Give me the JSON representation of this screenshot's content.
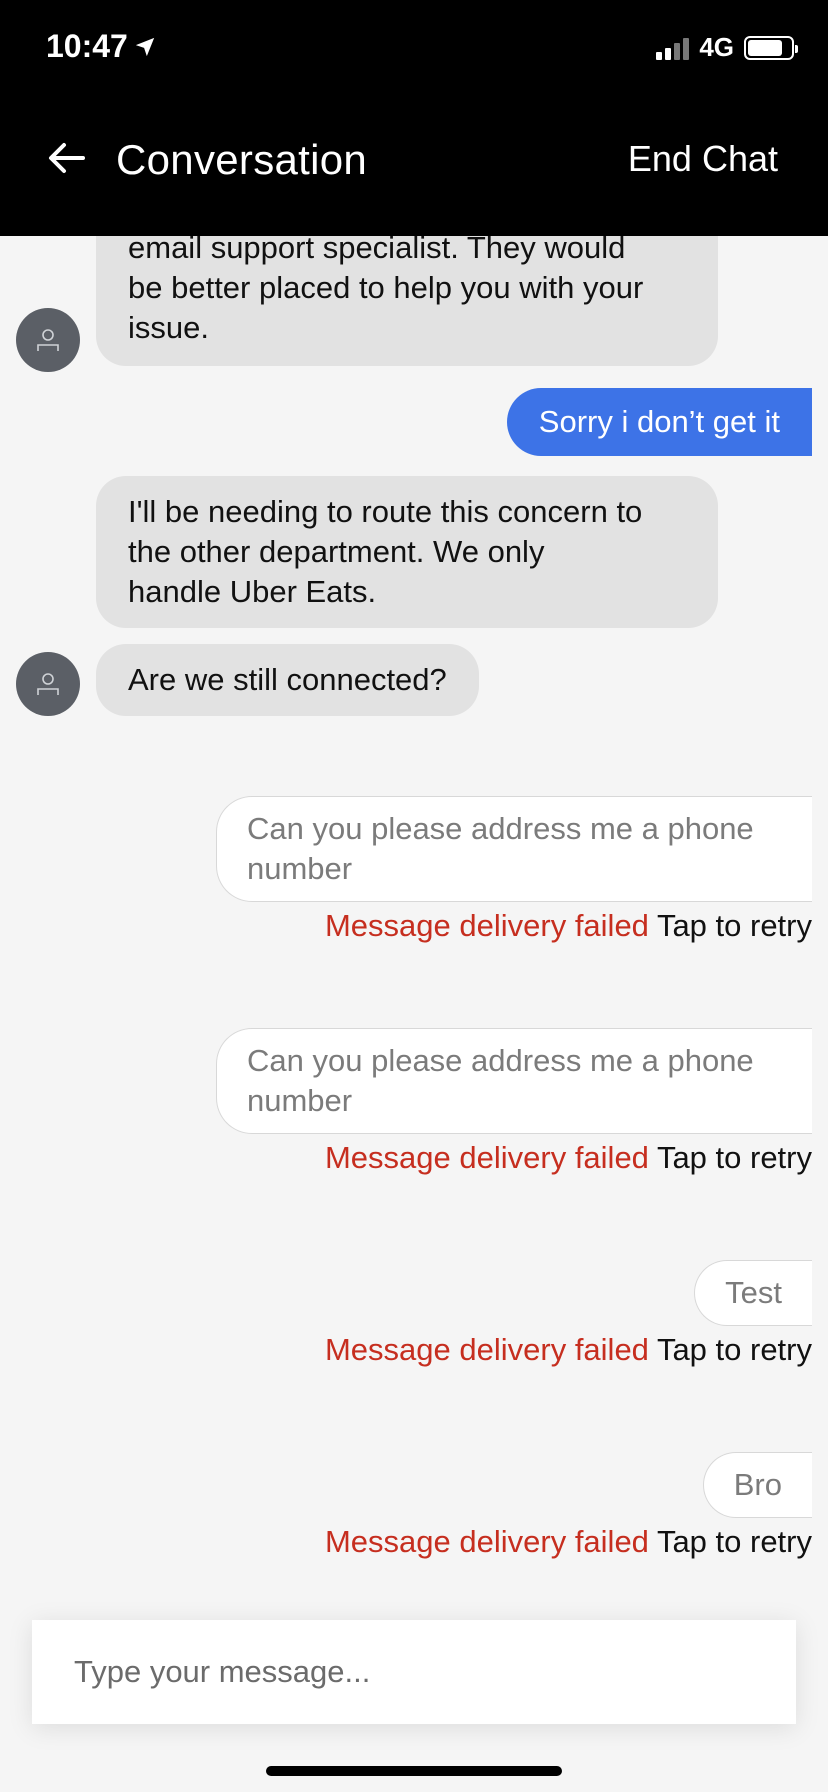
{
  "status_bar": {
    "time": "10:47",
    "network": "4G"
  },
  "header": {
    "title": "Conversation",
    "end_chat_label": "End Chat"
  },
  "messages": [
    {
      "from": "agent",
      "lines": [
        "email support specialist. They would",
        "be better placed to help you with your",
        "issue."
      ]
    },
    {
      "from": "me",
      "text": "Sorry i don’t get it"
    },
    {
      "from": "agent",
      "lines": [
        "I'll be needing to route this concern to",
        "the other department. We only",
        "handle Uber Eats."
      ]
    },
    {
      "from": "agent",
      "text": "Are we still connected?"
    },
    {
      "from": "me_failed",
      "lines": [
        "Can you please address me a phone",
        "number"
      ]
    },
    {
      "from": "me_failed",
      "lines": [
        "Can you please address me a phone",
        "number"
      ]
    },
    {
      "from": "me_failed",
      "text": "Test"
    },
    {
      "from": "me_failed",
      "text": "Bro"
    }
  ],
  "failure": {
    "error_text": "Message delivery failed",
    "retry_text": "Tap to retry",
    "error_color": "#c62e1f"
  },
  "composer": {
    "placeholder": "Type your message..."
  },
  "colors": {
    "header_bg": "#000000",
    "my_bubble": "#3d73e7",
    "agent_bubble": "#e2e2e2",
    "chat_bg": "#f5f5f5"
  },
  "icons": {
    "back": "arrow-left-icon",
    "avatar": "person-icon",
    "location": "location-arrow-icon"
  }
}
